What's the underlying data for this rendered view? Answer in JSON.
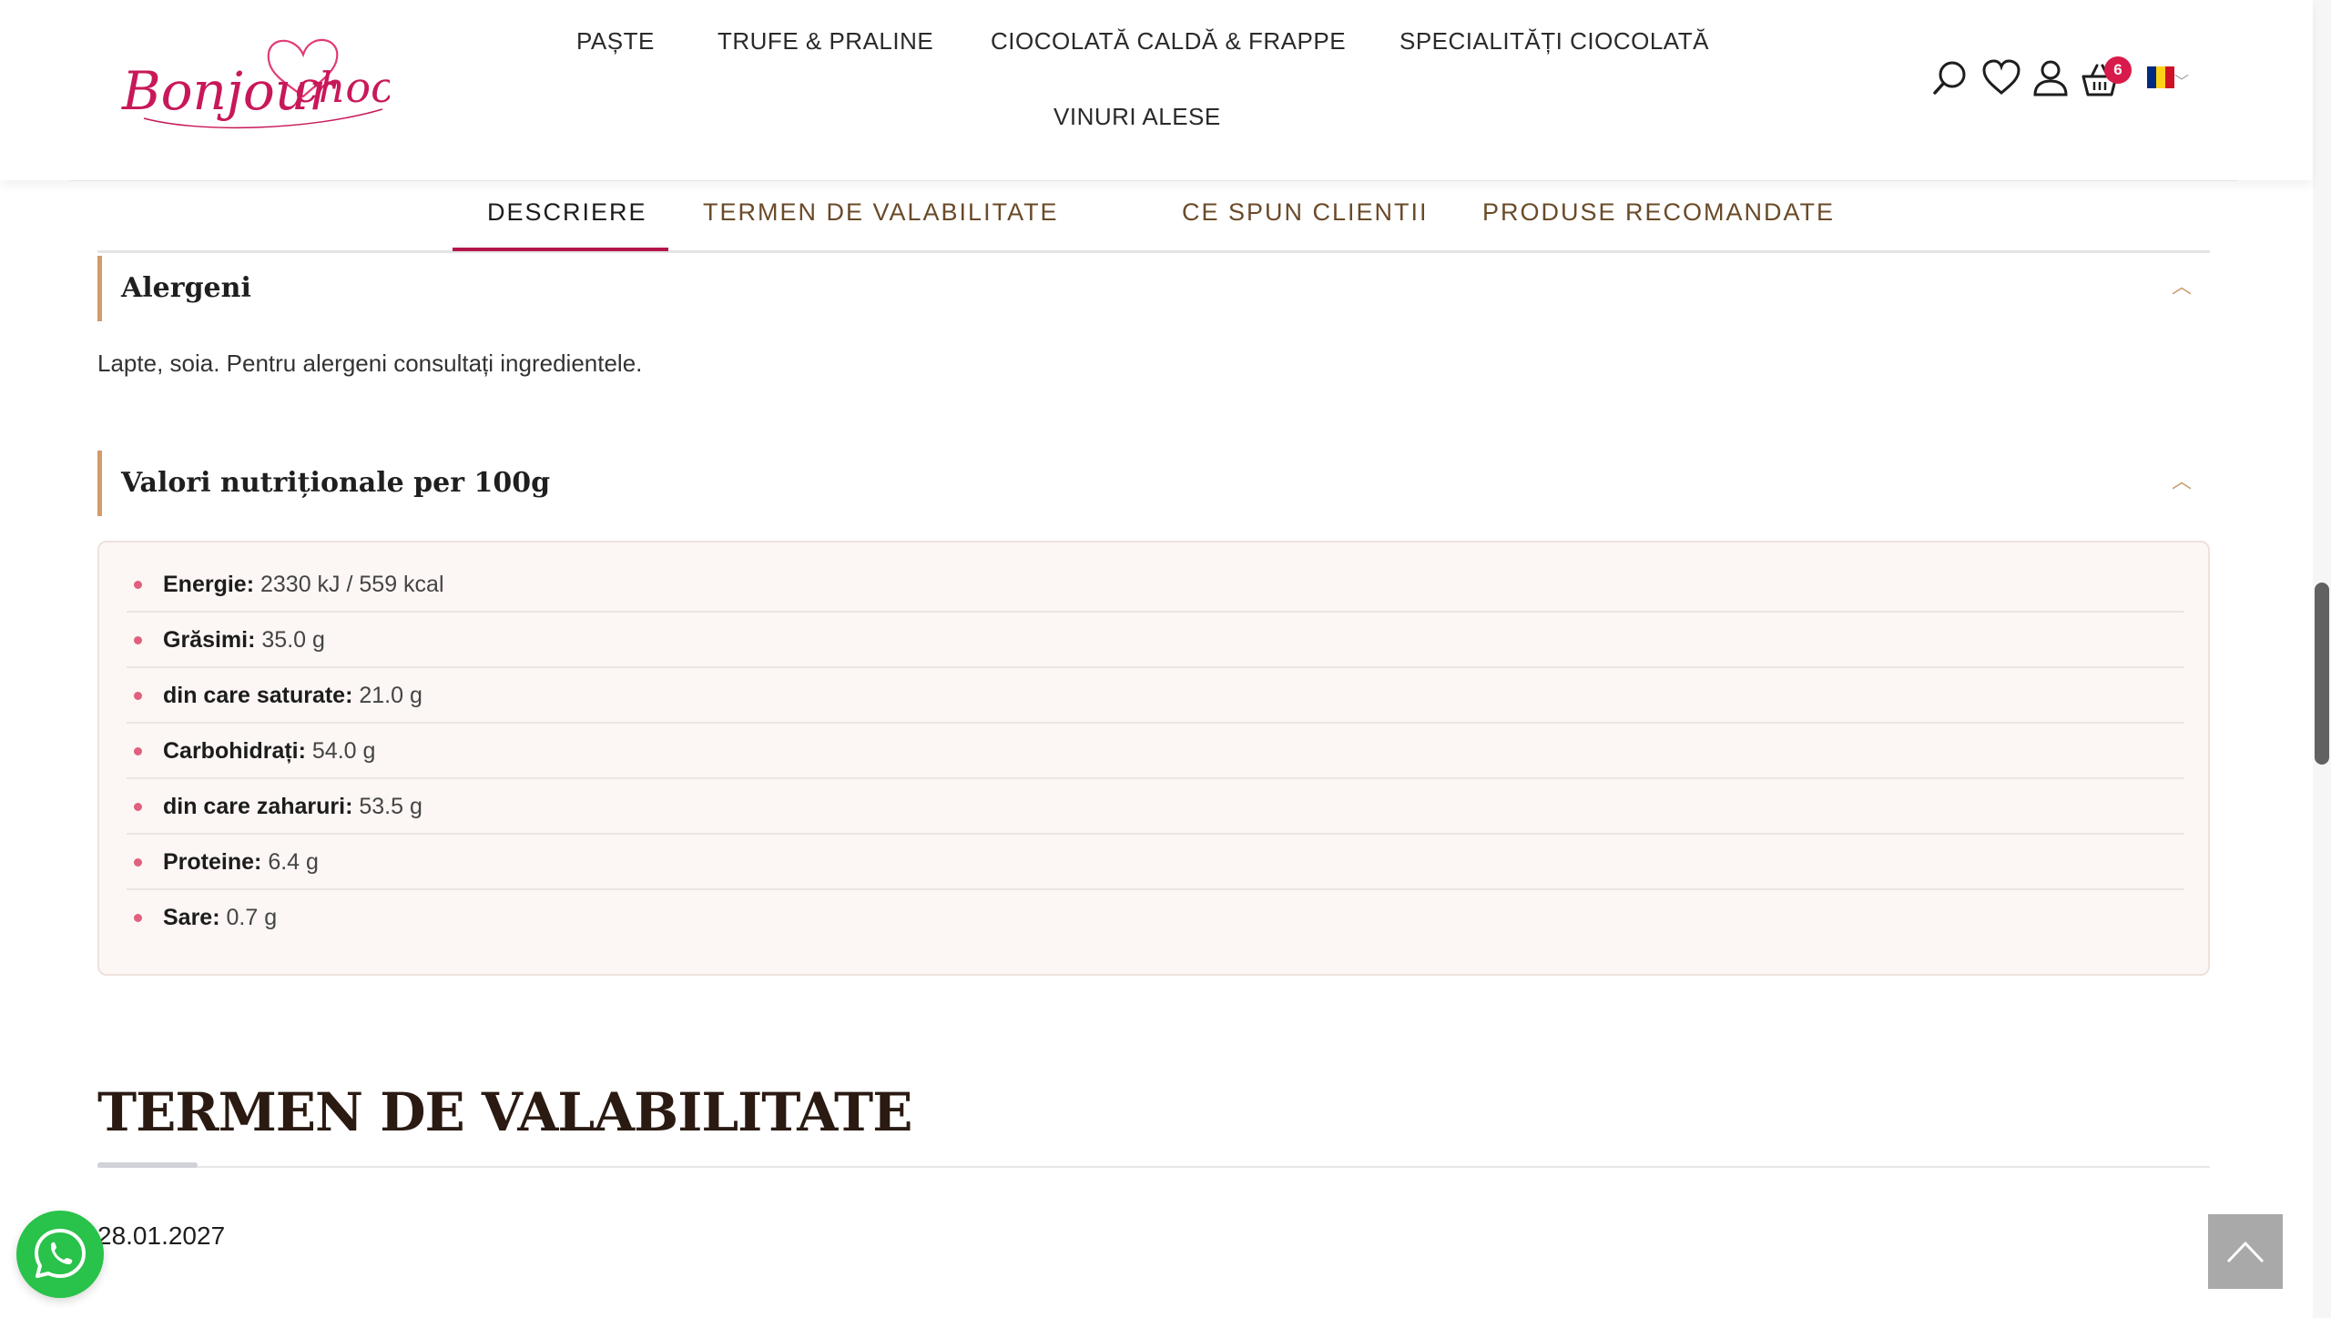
{
  "brand": {
    "logo_text": "Bonjour choco",
    "colors": {
      "accent": "#b5164a",
      "logo": "#c8185a"
    }
  },
  "nav": {
    "items": [
      "PAȘTE",
      "TRUFE & PRALINE",
      "CIOCOLATĂ CALDĂ & FRAPPE",
      "SPECIALITĂȚI CIOCOLATĂ",
      "VINURI ALESE"
    ]
  },
  "header_icons": {
    "search": "search-icon",
    "wishlist": "heart-icon",
    "account": "user-icon",
    "cart": "basket-icon",
    "cart_count": "6",
    "language": "romania-flag-icon"
  },
  "tabs": {
    "items": [
      "DESCRIERE",
      "TERMEN DE VALABILITATE",
      "CE SPUN CLIENTII",
      "PRODUSE RECOMANDATE"
    ],
    "active": "DESCRIERE"
  },
  "allergens": {
    "title": "Alergeni",
    "text": "Lapte, soia. Pentru alergeni consultați ingredientele."
  },
  "nutrition": {
    "title": "Valori nutriționale per 100g",
    "rows": [
      {
        "label": "Energie:",
        "value": "2330 kJ / 559 kcal"
      },
      {
        "label": "Grăsimi:",
        "value": "35.0 g"
      },
      {
        "label": "din care saturate:",
        "value": "21.0 g"
      },
      {
        "label": "Carbohidrați:",
        "value": "54.0 g"
      },
      {
        "label": "din care zaharuri:",
        "value": "53.5 g"
      },
      {
        "label": "Proteine:",
        "value": "6.4 g"
      },
      {
        "label": "Sare:",
        "value": "0.7 g"
      }
    ]
  },
  "shelf_life": {
    "title": "TERMEN DE VALABILITATE",
    "date": "28.01.2027"
  }
}
